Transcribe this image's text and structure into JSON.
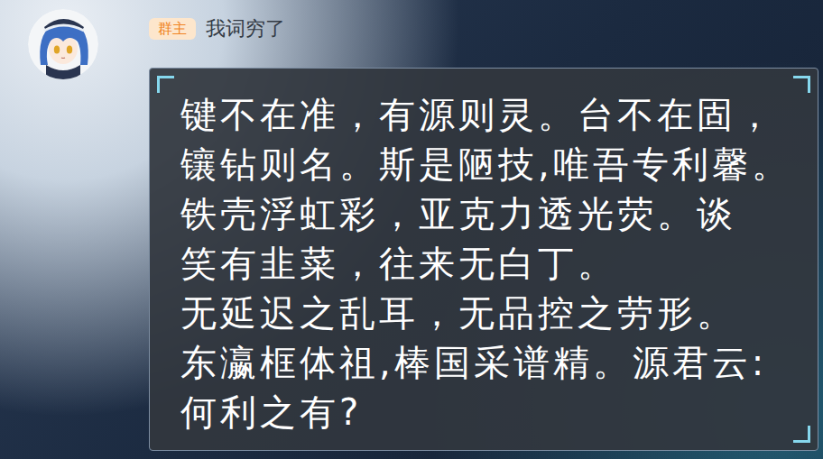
{
  "sender": {
    "name": "我词穷了",
    "badge": "群主"
  },
  "message": {
    "lines": [
      "键不在准，有源则灵。台不在固，",
      "镶钻则名。斯是陋技,唯吾专利馨。",
      "铁壳浮虹彩，亚克力透光荧。谈",
      "笑有韭菜，往来无白丁。",
      "无延迟之乱耳，无品控之劳形。",
      "东瀛框体祖,棒国采谱精。源君云:",
      "何利之有?"
    ]
  }
}
